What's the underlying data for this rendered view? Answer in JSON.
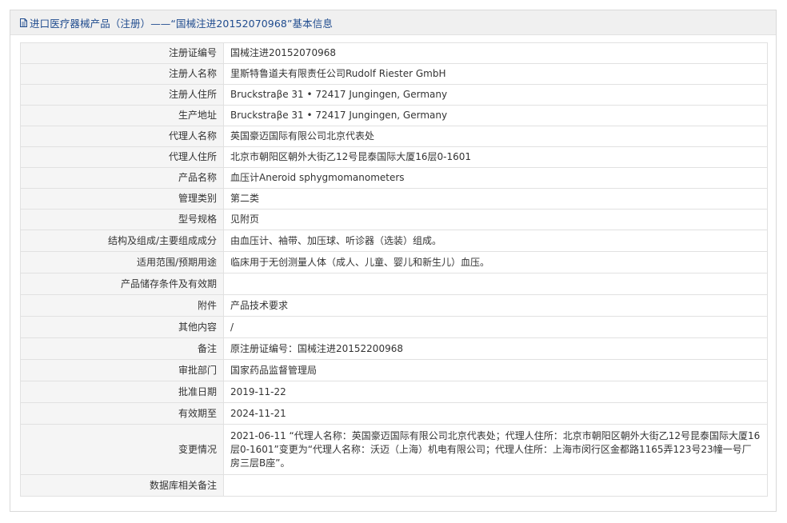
{
  "header": {
    "title": "进口医疗器械产品（注册）——“国械注进20152070968”基本信息"
  },
  "rows": [
    {
      "label": "注册证编号",
      "value": "国械注进20152070968"
    },
    {
      "label": "注册人名称",
      "value": "里斯特鲁道夫有限责任公司Rudolf Riester GmbH"
    },
    {
      "label": "注册人住所",
      "value": "Bruckstraβe 31 • 72417 Jungingen, Germany"
    },
    {
      "label": "生产地址",
      "value": "Bruckstraβe 31 • 72417 Jungingen, Germany"
    },
    {
      "label": "代理人名称",
      "value": "英国豪迈国际有限公司北京代表处"
    },
    {
      "label": "代理人住所",
      "value": "北京市朝阳区朝外大街乙12号昆泰国际大厦16层0-1601"
    },
    {
      "label": "产品名称",
      "value": "血压计Aneroid sphygmomanometers"
    },
    {
      "label": "管理类别",
      "value": "第二类"
    },
    {
      "label": "型号规格",
      "value": "见附页"
    },
    {
      "label": "结构及组成/主要组成成分",
      "value": "由血压计、袖带、加压球、听诊器（选装）组成。"
    },
    {
      "label": "适用范围/预期用途",
      "value": "临床用于无创测量人体（成人、儿童、婴儿和新生儿）血压。"
    },
    {
      "label": "产品储存条件及有效期",
      "value": ""
    },
    {
      "label": "附件",
      "value": "产品技术要求"
    },
    {
      "label": "其他内容",
      "value": "/"
    },
    {
      "label": "备注",
      "value": "原注册证编号：国械注进20152200968"
    },
    {
      "label": "审批部门",
      "value": "国家药品监督管理局"
    },
    {
      "label": "批准日期",
      "value": "2019-11-22"
    },
    {
      "label": "有效期至",
      "value": "2024-11-21"
    },
    {
      "label": "变更情况",
      "value": "2021-06-11 “代理人名称：英国豪迈国际有限公司北京代表处；代理人住所：北京市朝阳区朝外大街乙12号昆泰国际大厦16层0-1601”变更为“代理人名称：沃迈（上海）机电有限公司；代理人住所：上海市闵行区金都路1165弄123号23幢一号厂房三层B座”。"
    },
    {
      "label": "数据库相关备注",
      "value": ""
    }
  ]
}
